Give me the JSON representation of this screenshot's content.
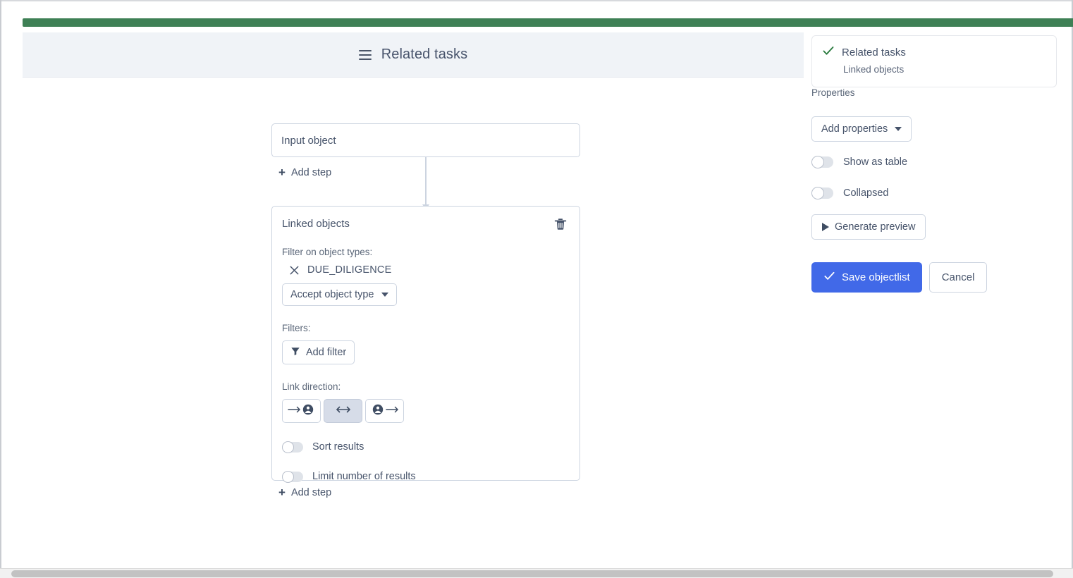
{
  "header": {
    "menu_icon": "hamburger-icon",
    "title": "Related tasks"
  },
  "colors": {
    "banner_green": "#3e8055",
    "primary_blue": "#4169e8",
    "check_green": "#2e7d42",
    "header_bg": "#f0f3f7",
    "border": "#ccd4e0"
  },
  "flow": {
    "input_node": {
      "label": "Input object"
    },
    "add_step_top": {
      "icon": "plus-icon",
      "label": "Add step"
    },
    "add_step_bottom": {
      "icon": "plus-icon",
      "label": "Add step"
    },
    "linked_objects_node": {
      "title": "Linked objects",
      "delete_icon": "trash-icon",
      "filter_on_object_types_label": "Filter on object types:",
      "object_type_chip": {
        "remove_icon": "close-x-icon",
        "label": "DUE_DILIGENCE"
      },
      "accept_object_type": {
        "label": "Accept object type",
        "icon": "chevron-down-icon"
      },
      "filters_label": "Filters:",
      "add_filter": {
        "icon": "filter-icon",
        "label": "Add filter"
      },
      "link_direction_label": "Link direction:",
      "link_direction_options": [
        {
          "name": "incoming",
          "icon": "arrow-to-person-icon",
          "selected": false
        },
        {
          "name": "both",
          "icon": "double-arrow-icon",
          "selected": true
        },
        {
          "name": "outgoing",
          "icon": "person-to-arrow-icon",
          "selected": false
        }
      ],
      "sort_results": {
        "label": "Sort results",
        "enabled": false
      },
      "limit_number_of_results": {
        "label": "Limit number of results",
        "enabled": false
      }
    }
  },
  "right_panel": {
    "summary": {
      "check_icon": "check-icon",
      "title": "Related tasks",
      "subtitle": "Linked objects"
    },
    "properties_label": "Properties",
    "add_properties": {
      "label": "Add properties",
      "icon": "chevron-down-icon"
    },
    "show_as_table": {
      "label": "Show as table",
      "enabled": false
    },
    "collapsed": {
      "label": "Collapsed",
      "enabled": false
    },
    "generate_preview": {
      "icon": "play-icon",
      "label": "Generate preview"
    },
    "save_button": {
      "icon": "check-icon",
      "label": "Save objectlist"
    },
    "cancel_button": {
      "label": "Cancel"
    }
  }
}
